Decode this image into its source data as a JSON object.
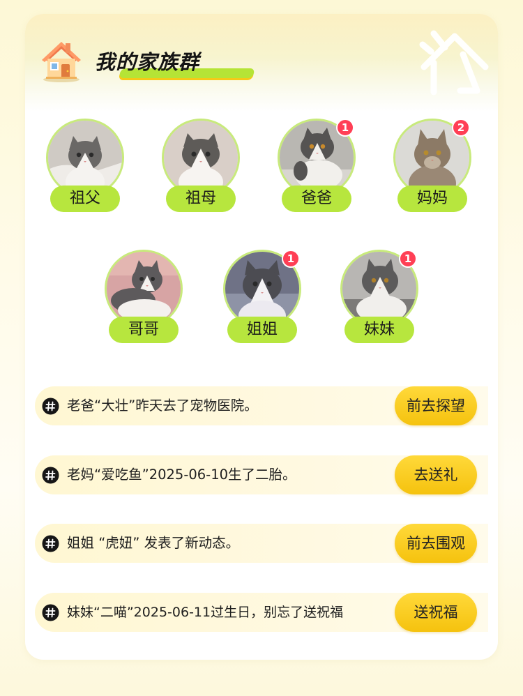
{
  "header": {
    "title": "我的家族群"
  },
  "members": [
    {
      "name": "祖父",
      "badge": "",
      "fur": "#6a6866",
      "bg": "#cfcac4"
    },
    {
      "name": "祖母",
      "badge": "",
      "fur": "#5e5b58",
      "bg": "#d9cfc8"
    },
    {
      "name": "爸爸",
      "badge": "1",
      "fur": "#555352",
      "bg": "#b9b7b2"
    },
    {
      "name": "妈妈",
      "badge": "2",
      "fur": "#8c7a66",
      "bg": "#dbdad6"
    },
    {
      "name": "哥哥",
      "badge": "",
      "fur": "#5d5a5c",
      "bg": "#d7a4a4"
    },
    {
      "name": "姐姐",
      "badge": "1",
      "fur": "#4c4c52",
      "bg": "#6f7286"
    },
    {
      "name": "妹妹",
      "badge": "1",
      "fur": "#5c5b5b",
      "bg": "#b8b6b3"
    }
  ],
  "notices": [
    {
      "text": "老爸“大壮”昨天去了宠物医院。",
      "action": "前去探望"
    },
    {
      "text": "老妈“爱吃鱼”2025-06-10生了二胎。",
      "action": "去送礼"
    },
    {
      "text": "姐姐 “虎妞” 发表了新动态。",
      "action": "前去围观"
    },
    {
      "text": "妹妹“二喵”2025-06-11过生日，别忘了送祝福",
      "action": "送祝福"
    }
  ],
  "colors": {
    "accent_green": "#b7e63e",
    "button_yellow": "#f5c20e",
    "badge_red": "#ff3f55",
    "notice_bg": "#fff7d2"
  },
  "icons": {
    "house": "house-icon",
    "decoration": "house-outline-icon",
    "notice": "hashtag-icon",
    "avatar": "cat-photo"
  }
}
